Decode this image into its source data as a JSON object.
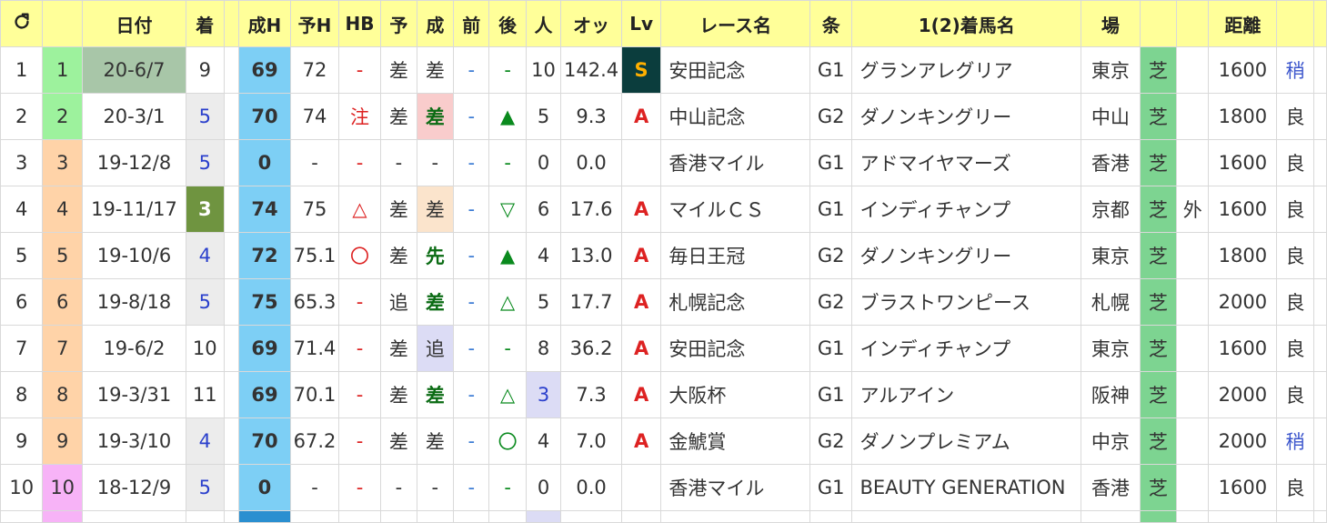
{
  "header": {
    "refresh_icon": "refresh-icon",
    "columns": [
      "",
      "",
      "日付",
      "着",
      "",
      "成H",
      "予H",
      "HB",
      "予",
      "成",
      "前",
      "後",
      "人",
      "オッ",
      "Lv",
      "レース名",
      "条",
      "1(2)着馬名",
      "場",
      "",
      "",
      "距離",
      "",
      ""
    ]
  },
  "colors": {
    "header_bg": "#ffff99",
    "seiH_bg": "#7dcff5",
    "turf_bg": "#7dd491",
    "lv_S_bg": "#0b3d3d",
    "lv_S_fg": "#ffb000",
    "lv_A_fg": "#dd2222"
  },
  "rows": [
    {
      "n": "1",
      "idx": "1",
      "date": "20-6/7",
      "chaku": "9",
      "seiH": "69",
      "yoH": "72",
      "hb": "-",
      "yo": "差",
      "sei": "差",
      "mae": "-",
      "ato": "-",
      "nin": "10",
      "odds": "142.4",
      "lv": "S",
      "race": "安田記念",
      "jou": "G1",
      "horse": "グランアレグリア",
      "ba": "東京",
      "surface": "芝",
      "inout": "",
      "dist": "1600",
      "baba": "稍"
    },
    {
      "n": "2",
      "idx": "2",
      "date": "20-3/1",
      "chaku": "5",
      "seiH": "70",
      "yoH": "74",
      "hb": "注",
      "yo": "差",
      "sei": "差",
      "mae": "-",
      "ato": "▲",
      "nin": "5",
      "odds": "9.3",
      "lv": "A",
      "race": "中山記念",
      "jou": "G2",
      "horse": "ダノンキングリー",
      "ba": "中山",
      "surface": "芝",
      "inout": "",
      "dist": "1800",
      "baba": "良"
    },
    {
      "n": "3",
      "idx": "3",
      "date": "19-12/8",
      "chaku": "5",
      "seiH": "0",
      "yoH": "-",
      "hb": "-",
      "yo": "-",
      "sei": "-",
      "mae": "-",
      "ato": "-",
      "nin": "0",
      "odds": "0.0",
      "lv": "",
      "race": "香港マイル",
      "jou": "G1",
      "horse": "アドマイヤマーズ",
      "ba": "香港",
      "surface": "芝",
      "inout": "",
      "dist": "1600",
      "baba": "良"
    },
    {
      "n": "4",
      "idx": "4",
      "date": "19-11/17",
      "chaku": "3",
      "seiH": "74",
      "yoH": "75",
      "hb": "△",
      "yo": "差",
      "sei": "差",
      "mae": "-",
      "ato": "▽",
      "nin": "6",
      "odds": "17.6",
      "lv": "A",
      "race": "マイルＣＳ",
      "jou": "G1",
      "horse": "インディチャンプ",
      "ba": "京都",
      "surface": "芝",
      "inout": "外",
      "dist": "1600",
      "baba": "良"
    },
    {
      "n": "5",
      "idx": "5",
      "date": "19-10/6",
      "chaku": "4",
      "seiH": "72",
      "yoH": "75.1",
      "hb": "〇",
      "yo": "差",
      "sei": "先",
      "mae": "-",
      "ato": "▲",
      "nin": "4",
      "odds": "13.0",
      "lv": "A",
      "race": "毎日王冠",
      "jou": "G2",
      "horse": "ダノンキングリー",
      "ba": "東京",
      "surface": "芝",
      "inout": "",
      "dist": "1800",
      "baba": "良"
    },
    {
      "n": "6",
      "idx": "6",
      "date": "19-8/18",
      "chaku": "5",
      "seiH": "75",
      "yoH": "65.3",
      "hb": "-",
      "yo": "追",
      "sei": "差",
      "mae": "-",
      "ato": "△",
      "nin": "5",
      "odds": "17.7",
      "lv": "A",
      "race": "札幌記念",
      "jou": "G2",
      "horse": "ブラストワンピース",
      "ba": "札幌",
      "surface": "芝",
      "inout": "",
      "dist": "2000",
      "baba": "良"
    },
    {
      "n": "7",
      "idx": "7",
      "date": "19-6/2",
      "chaku": "10",
      "seiH": "69",
      "yoH": "71.4",
      "hb": "-",
      "yo": "差",
      "sei": "追",
      "mae": "-",
      "ato": "-",
      "nin": "8",
      "odds": "36.2",
      "lv": "A",
      "race": "安田記念",
      "jou": "G1",
      "horse": "インディチャンプ",
      "ba": "東京",
      "surface": "芝",
      "inout": "",
      "dist": "1600",
      "baba": "良"
    },
    {
      "n": "8",
      "idx": "8",
      "date": "19-3/31",
      "chaku": "11",
      "seiH": "69",
      "yoH": "70.1",
      "hb": "-",
      "yo": "差",
      "sei": "差",
      "mae": "-",
      "ato": "△",
      "nin": "3",
      "odds": "7.3",
      "lv": "A",
      "race": "大阪杯",
      "jou": "G1",
      "horse": "アルアイン",
      "ba": "阪神",
      "surface": "芝",
      "inout": "",
      "dist": "2000",
      "baba": "良"
    },
    {
      "n": "9",
      "idx": "9",
      "date": "19-3/10",
      "chaku": "4",
      "seiH": "70",
      "yoH": "67.2",
      "hb": "-",
      "yo": "差",
      "sei": "差",
      "mae": "-",
      "ato": "〇",
      "nin": "4",
      "odds": "7.0",
      "lv": "A",
      "race": "金鯱賞",
      "jou": "G2",
      "horse": "ダノンプレミアム",
      "ba": "中京",
      "surface": "芝",
      "inout": "",
      "dist": "2000",
      "baba": "稍"
    },
    {
      "n": "10",
      "idx": "10",
      "date": "18-12/9",
      "chaku": "5",
      "seiH": "0",
      "yoH": "-",
      "hb": "-",
      "yo": "-",
      "sei": "-",
      "mae": "-",
      "ato": "-",
      "nin": "0",
      "odds": "0.0",
      "lv": "",
      "race": "香港マイル",
      "jou": "G1",
      "horse": "BEAUTY GENERATION",
      "ba": "香港",
      "surface": "芝",
      "inout": "",
      "dist": "1600",
      "baba": "良"
    }
  ]
}
